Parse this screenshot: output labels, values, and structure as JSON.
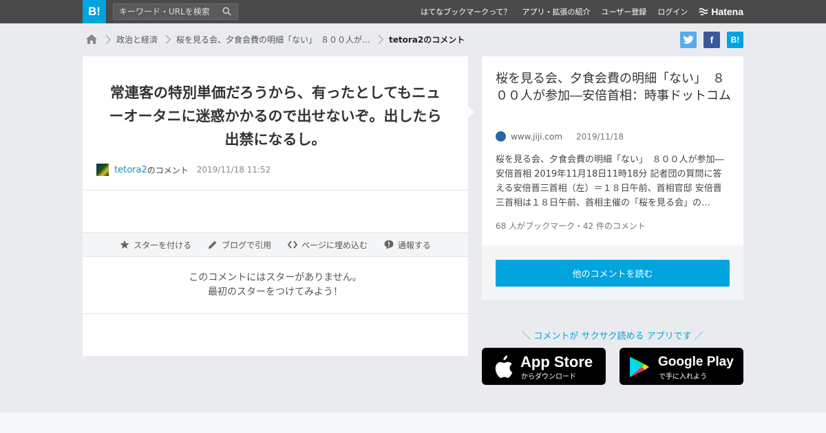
{
  "header": {
    "logo": "B!",
    "search_placeholder": "キーワード・URLを検索",
    "nav": [
      "はてなブックマークって？",
      "アプリ・拡張の紹介",
      "ユーザー登録",
      "ログイン"
    ],
    "hatena_label": "Hatena"
  },
  "breadcrumb": {
    "items": [
      "政治と経済",
      "桜を見る会、夕食会費の明細「ない」　８００人が…"
    ],
    "current": "tetora2のコメント"
  },
  "share": {
    "twitter": "t",
    "facebook": "f",
    "hatebu": "B!"
  },
  "comment": {
    "text": "常連客の特別単価だろうから、有ったとしてもニューオータニに迷惑かかるので出せないぞ。出したら出禁になるし。",
    "user": "tetora2",
    "user_suffix": "のコメント",
    "date": "2019/11/18 11:52"
  },
  "actions": {
    "star": "スターを付ける",
    "blog": "ブログで引用",
    "embed": "ページに埋め込む",
    "report": "通報する"
  },
  "no_star": {
    "line1": "このコメントにはスターがありません。",
    "line2": "最初のスターをつけてみよう！"
  },
  "entry": {
    "title": "桜を見る会、夕食会費の明細「ない」　８００人が参加―安倍首相：時事ドットコム",
    "domain": "www.jiji.com",
    "date": "2019/11/18",
    "summary": "桜を見る会、夕食会費の明細「ない」　８００人が参加―安倍首相 2019年11月18日11時18分 記者団の質問に答える安倍晋三首相（左）＝１８日午前、首相官邸 安倍晋三首相は１８日午前、首相主催の「桜を見る会」の…",
    "stats": "68 人がブックマーク・42 件のコメント",
    "read_button": "他のコメントを読む"
  },
  "app_promo": {
    "text": "＼ コメントが サクサク読める アプリです ／",
    "appstore_big": "App Store",
    "appstore_small": "からダウンロード",
    "googleplay_big": "Google Play",
    "googleplay_small": "で手に入れよう"
  },
  "colors": {
    "accent": "#00a4de",
    "topbar": "#4a4a4a",
    "twitter": "#55acee",
    "facebook": "#3b5998"
  }
}
